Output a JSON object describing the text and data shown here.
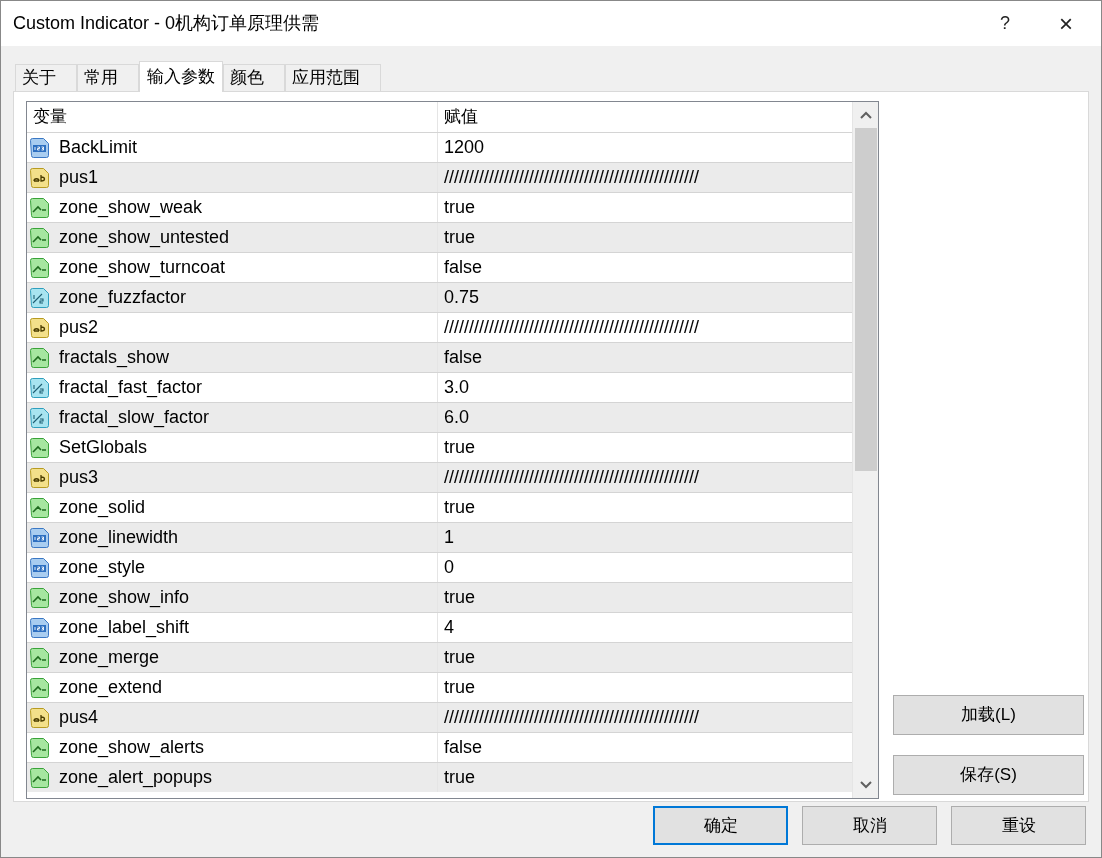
{
  "window": {
    "title": "Custom Indicator - 0机构订单原理供需",
    "help": "?",
    "close": "×"
  },
  "tabs": [
    {
      "label": "关于",
      "selected": false
    },
    {
      "label": "常用",
      "selected": false
    },
    {
      "label": "输入参数",
      "selected": true
    },
    {
      "label": "颜色",
      "selected": false
    },
    {
      "label": "应用范围",
      "selected": false
    }
  ],
  "table": {
    "columns": [
      "变量",
      "赋值"
    ],
    "rows": [
      {
        "kind": "int",
        "name": "BackLimit",
        "value": "1200"
      },
      {
        "kind": "string",
        "name": "pus1",
        "value": "///////////////////////////////////////////////////"
      },
      {
        "kind": "bool",
        "name": "zone_show_weak",
        "value": "true"
      },
      {
        "kind": "bool",
        "name": "zone_show_untested",
        "value": "true"
      },
      {
        "kind": "bool",
        "name": "zone_show_turncoat",
        "value": "false"
      },
      {
        "kind": "double",
        "name": "zone_fuzzfactor",
        "value": "0.75"
      },
      {
        "kind": "string",
        "name": "pus2",
        "value": "///////////////////////////////////////////////////"
      },
      {
        "kind": "bool",
        "name": "fractals_show",
        "value": "false"
      },
      {
        "kind": "double",
        "name": "fractal_fast_factor",
        "value": "3.0"
      },
      {
        "kind": "double",
        "name": "fractal_slow_factor",
        "value": "6.0"
      },
      {
        "kind": "bool",
        "name": "SetGlobals",
        "value": "true"
      },
      {
        "kind": "string",
        "name": "pus3",
        "value": "///////////////////////////////////////////////////"
      },
      {
        "kind": "bool",
        "name": "zone_solid",
        "value": "true"
      },
      {
        "kind": "int",
        "name": "zone_linewidth",
        "value": "1"
      },
      {
        "kind": "int",
        "name": "zone_style",
        "value": "0"
      },
      {
        "kind": "bool",
        "name": "zone_show_info",
        "value": "true"
      },
      {
        "kind": "int",
        "name": "zone_label_shift",
        "value": "4"
      },
      {
        "kind": "bool",
        "name": "zone_merge",
        "value": "true"
      },
      {
        "kind": "bool",
        "name": "zone_extend",
        "value": "true"
      },
      {
        "kind": "string",
        "name": "pus4",
        "value": "///////////////////////////////////////////////////"
      },
      {
        "kind": "bool",
        "name": "zone_show_alerts",
        "value": "false"
      },
      {
        "kind": "bool",
        "name": "zone_alert_popups",
        "value": "true"
      }
    ]
  },
  "side_buttons": [
    "加载(L)",
    "保存(S)"
  ],
  "buttons": [
    {
      "label": "确定",
      "focused": true
    },
    {
      "label": "取消",
      "focused": false
    },
    {
      "label": "重设",
      "focused": false
    }
  ]
}
